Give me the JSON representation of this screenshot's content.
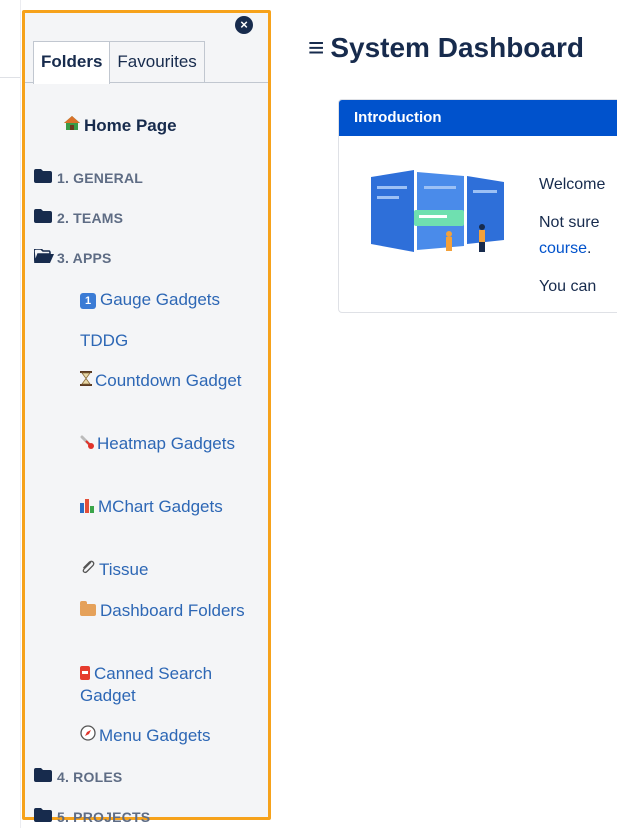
{
  "panel": {
    "close_glyph": "×",
    "tabs": [
      {
        "label": "Folders",
        "active": true
      },
      {
        "label": "Favourites",
        "active": false
      }
    ],
    "home": {
      "icon": "home-icon",
      "label": "Home Page"
    },
    "folders": [
      {
        "label": "1. GENERAL",
        "icon": "folder-closed-icon"
      },
      {
        "label": "2. TEAMS",
        "icon": "folder-closed-icon"
      },
      {
        "label": "3. APPS",
        "icon": "folder-open-icon"
      },
      {
        "label": "4. ROLES",
        "icon": "folder-closed-icon"
      },
      {
        "label": "5. PROJECTS",
        "icon": "folder-closed-icon"
      }
    ],
    "apps": [
      {
        "label": "Gauge Gadgets",
        "icon": "number-one-icon",
        "icon_text": "1"
      },
      {
        "label": "TDDG",
        "icon": ""
      },
      {
        "label": "Countdown Gadget",
        "icon": "hourglass-icon"
      },
      {
        "label": "Heatmap Gadgets",
        "icon": "thermometer-icon"
      },
      {
        "label": "MChart Gadgets",
        "icon": "bar-chart-icon"
      },
      {
        "label": "Tissue",
        "icon": "paperclip-icon"
      },
      {
        "label": "Dashboard Folders",
        "icon": "folder-box-icon"
      },
      {
        "label": "Canned Search Gadget",
        "icon": "can-icon"
      },
      {
        "label": "Menu Gadgets",
        "icon": "compass-icon"
      }
    ]
  },
  "dashboard": {
    "hamburger": "≡",
    "title": "System Dashboard",
    "card": {
      "header": "Introduction",
      "line1": "Welcome",
      "line2": "Not sure",
      "line3_link": "course",
      "line3_rest": ".",
      "line4": "You can"
    }
  },
  "colors": {
    "panel_border": "#f6a21b",
    "link": "#2d67b5",
    "card_header": "#0052cc",
    "text": "#172b4d"
  }
}
